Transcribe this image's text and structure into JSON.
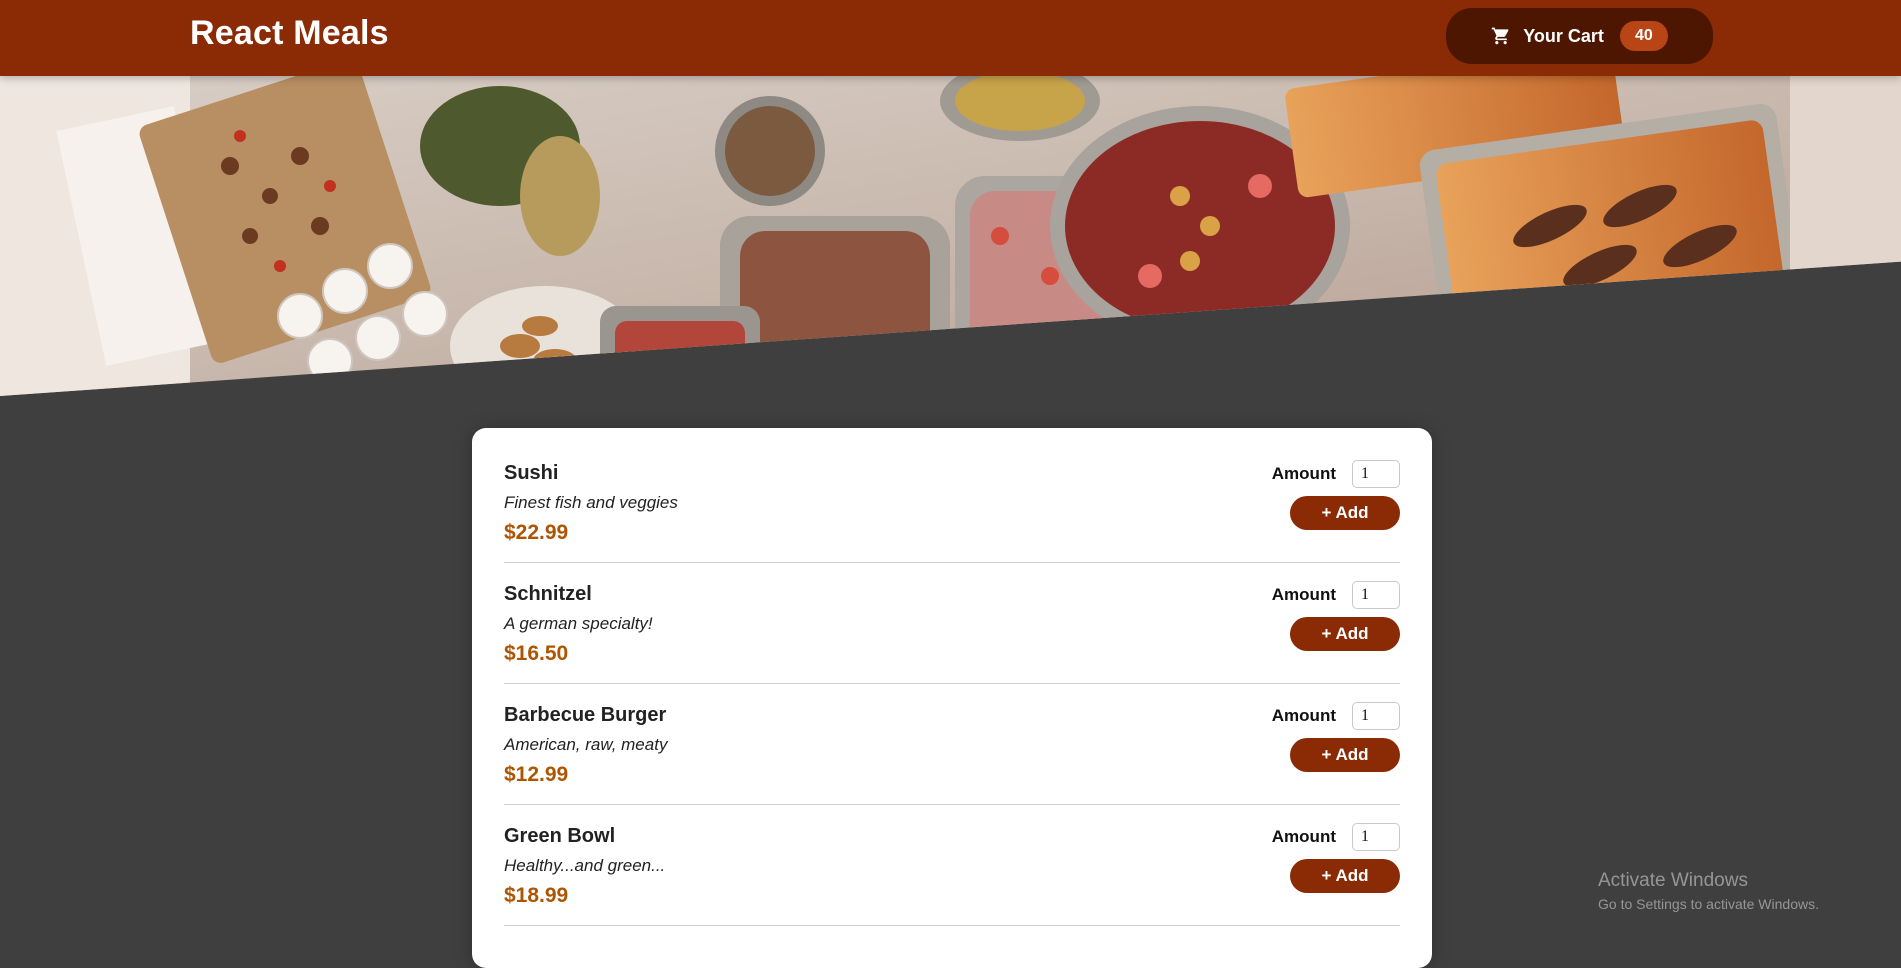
{
  "header": {
    "title": "React Meals",
    "cart_label": "Your Cart",
    "cart_count": "40",
    "cart_icon": "cart-icon"
  },
  "hero": {
    "description_image": "buffet table with food platters"
  },
  "meals": [
    {
      "name": "Sushi",
      "description": "Finest fish and veggies",
      "price": "$22.99",
      "amount_label": "Amount",
      "amount_value": "1",
      "add_label": "+ Add"
    },
    {
      "name": "Schnitzel",
      "description": "A german specialty!",
      "price": "$16.50",
      "amount_label": "Amount",
      "amount_value": "1",
      "add_label": "+ Add"
    },
    {
      "name": "Barbecue Burger",
      "description": "American, raw, meaty",
      "price": "$12.99",
      "amount_label": "Amount",
      "amount_value": "1",
      "add_label": "+ Add"
    },
    {
      "name": "Green Bowl",
      "description": "Healthy...and green...",
      "price": "$18.99",
      "amount_label": "Amount",
      "amount_value": "1",
      "add_label": "+ Add"
    }
  ],
  "watermark": {
    "title": "Activate Windows",
    "subtitle": "Go to Settings to activate Windows."
  },
  "colors": {
    "header_bg": "#8a2b06",
    "cart_bg": "#4d1601",
    "badge_bg": "#b94517",
    "price": "#ad5502",
    "page_bg": "#3f3f3f"
  }
}
